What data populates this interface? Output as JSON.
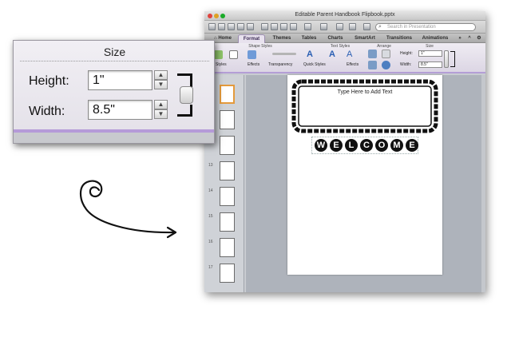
{
  "window": {
    "title": "Editable Parent Handbook Flipbook.pptx",
    "search_placeholder": "Search in Presentation"
  },
  "tabs": [
    {
      "label": "Home"
    },
    {
      "label": "Format",
      "active": true
    },
    {
      "label": "Themes"
    },
    {
      "label": "Tables"
    },
    {
      "label": "Charts"
    },
    {
      "label": "SmartArt"
    },
    {
      "label": "Transitions"
    },
    {
      "label": "Animations"
    }
  ],
  "ribbon": {
    "groups": {
      "shape_styles": "Shape Styles",
      "text_styles": "Text Styles",
      "arrange": "Arrange",
      "size": "Size"
    },
    "buttons": {
      "styles": "Styles",
      "effects": "Effects",
      "transparency": "Transparency",
      "quick_styles": "Quick Styles",
      "text_effects": "Effects"
    },
    "size": {
      "height_label": "Height:",
      "height_value": "1\"",
      "width_label": "Width:",
      "width_value": "8.5\""
    }
  },
  "thumbnails": {
    "numbers": [
      "13",
      "14",
      "15",
      "16",
      "17"
    ]
  },
  "slide": {
    "placeholder_text": "Type Here to Add Text",
    "welcome_letters": [
      "W",
      "E",
      "L",
      "C",
      "O",
      "M",
      "E"
    ]
  },
  "callout": {
    "title": "Size",
    "height_label": "Height:",
    "height_value": "1\"",
    "width_label": "Width:",
    "width_value": "8.5\""
  },
  "colors": {
    "accent_purple": "#b59ad8",
    "selection_orange": "#e49a3c"
  }
}
